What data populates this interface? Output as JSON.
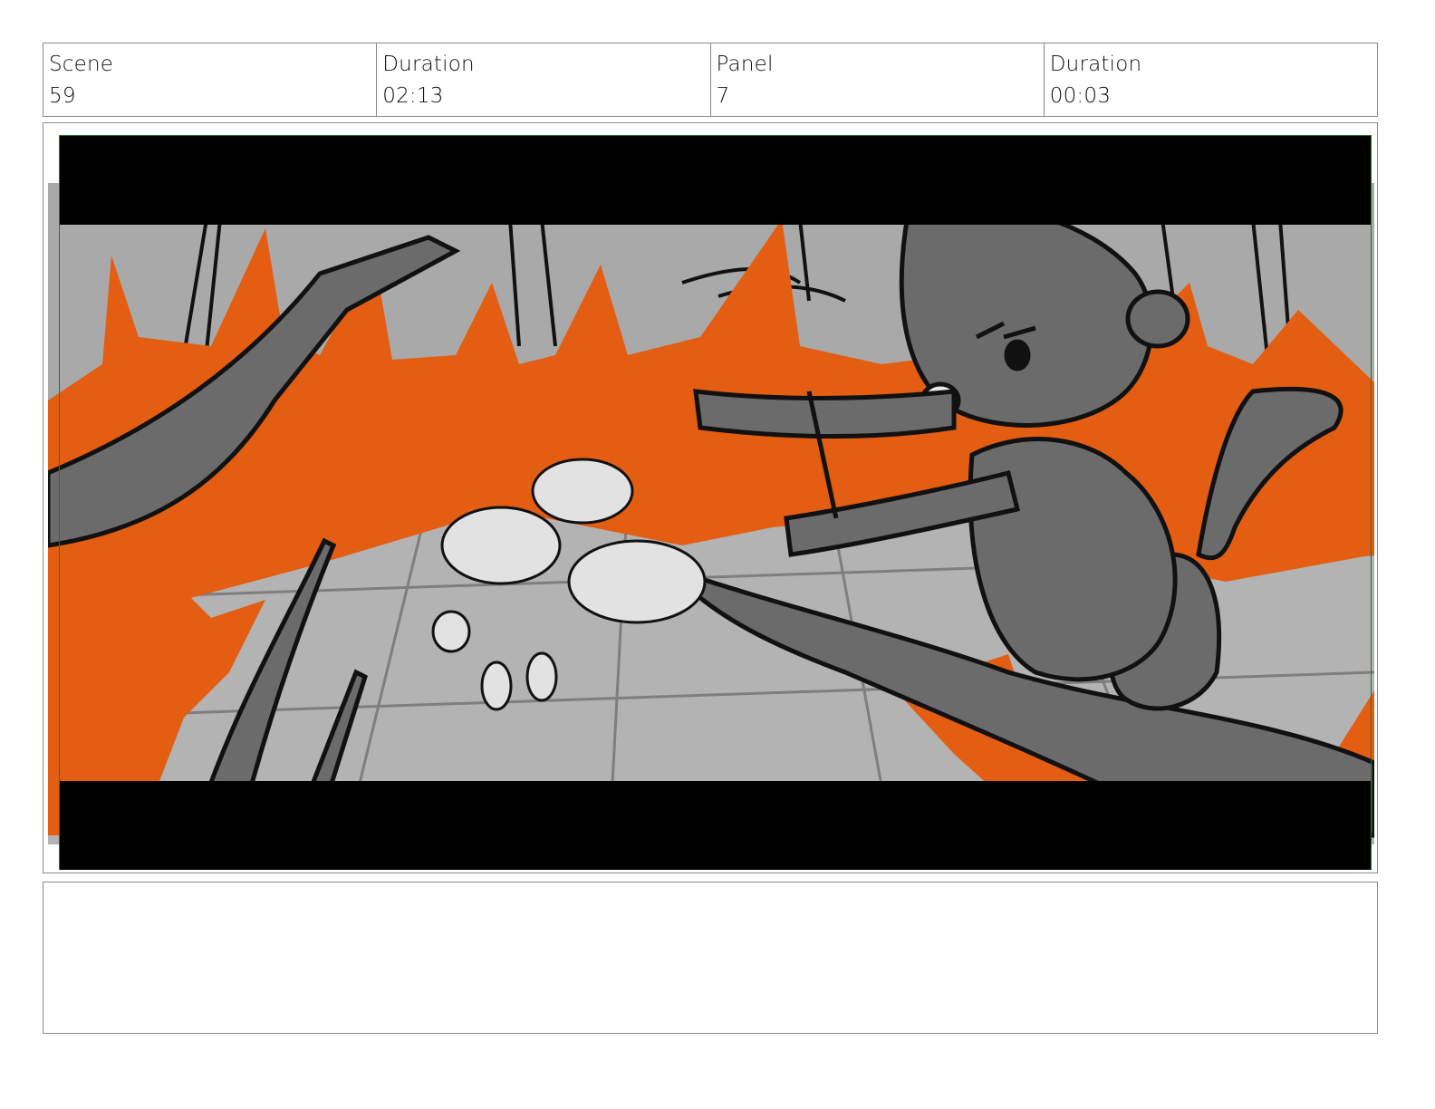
{
  "header": {
    "scene_label": "Scene",
    "scene_value": "59",
    "scene_duration_label": "Duration",
    "scene_duration_value": "02:13",
    "panel_label": "Panel",
    "panel_value": "7",
    "panel_duration_label": "Duration",
    "panel_duration_value": "00:03"
  },
  "panel": {
    "colors": {
      "letterbox": "#000000",
      "fire": "#e35d12",
      "ground": "#a9a9a9",
      "tree_gray": "#6b6b6b",
      "safe_frame": "#1d7a1d"
    }
  },
  "notes": {
    "text": ""
  }
}
